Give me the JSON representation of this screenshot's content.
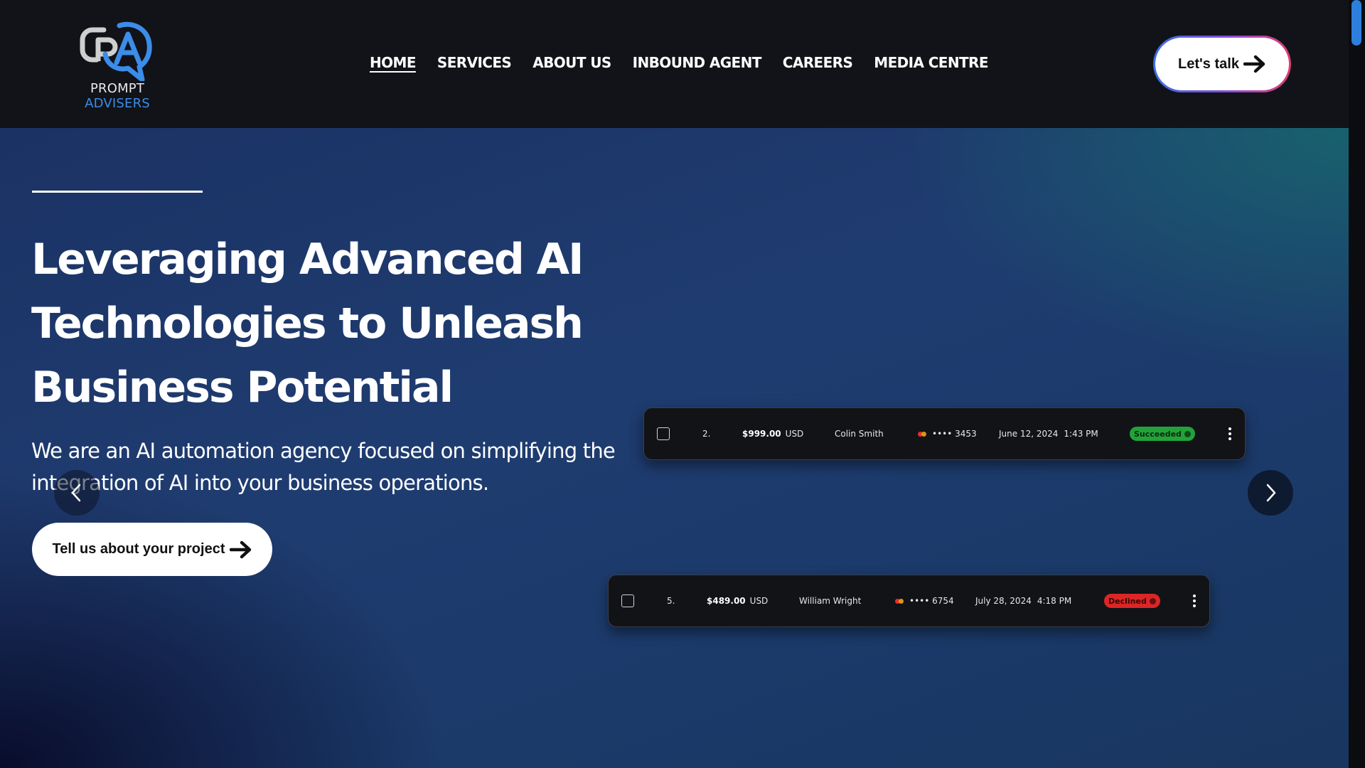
{
  "brand": {
    "name_part1": "PROMPT",
    "name_part2": "ADVISERS",
    "colors": {
      "blue": "#3b8de8",
      "grey": "#cfcfcf"
    }
  },
  "nav": {
    "items": [
      {
        "label": "HOME",
        "active": true
      },
      {
        "label": "SERVICES",
        "active": false
      },
      {
        "label": "ABOUT US",
        "active": false
      },
      {
        "label": "INBOUND AGENT",
        "active": false
      },
      {
        "label": "CAREERS",
        "active": false
      },
      {
        "label": "MEDIA CENTRE",
        "active": false
      }
    ],
    "cta_label": "Let's talk",
    "cta_icon": "arrow-right-icon"
  },
  "hero": {
    "title": "Leveraging Advanced AI Technologies to Unleash Business Potential",
    "subtitle": "We are an AI automation agency focused on simplifying the integration of AI into your business operations.",
    "cta_label": "Tell us about your project",
    "cta_icon": "arrow-right-icon",
    "background_colors": [
      "#1b3264",
      "#1f3c70",
      "#166e6e"
    ]
  },
  "transactions": [
    {
      "index": "2.",
      "amount": "$999.00",
      "currency": "USD",
      "customer": "Colin  Smith",
      "card": "•••• 3453",
      "date": "June 12, 2024",
      "time": "1:43 PM",
      "status": "Succeeded",
      "status_color": "#22a33a"
    },
    {
      "index": "5.",
      "amount": "$489.00",
      "currency": "USD",
      "customer": "William  Wright",
      "card": "•••• 6754",
      "date": "July 28, 2024",
      "time": "4:18 PM",
      "status": "Declined",
      "status_color": "#dc2626"
    }
  ],
  "carousel": {
    "prev_icon": "chevron-left-icon",
    "next_icon": "chevron-right-icon"
  },
  "scrollbar": {
    "thumb_color": "#2d7fde"
  }
}
